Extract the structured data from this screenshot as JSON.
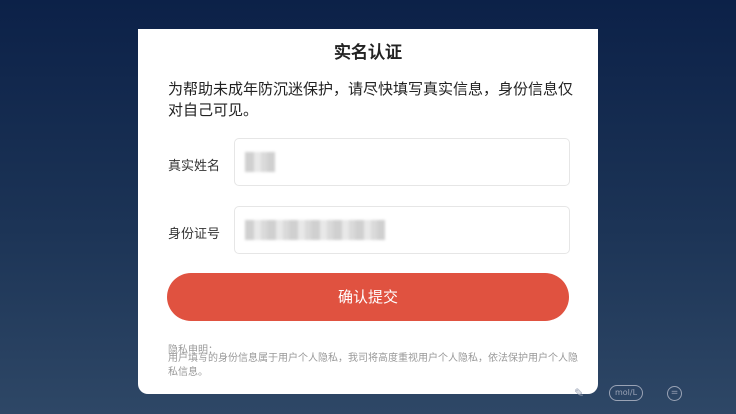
{
  "dialog": {
    "title": "实名认证",
    "intro": "为帮助未成年防沉迷保护，请尽快填写真实信息，身份信息仅对自己可见。",
    "fields": [
      {
        "label": "真实姓名",
        "value": ""
      },
      {
        "label": "身份证号",
        "value": ""
      }
    ],
    "submit_label": "确认提交",
    "privacy_title": "隐私申明：",
    "privacy_text": "用户填写的身份信息属于用户个人隐私，我司将高度重视用户个人隐私，依法保护用户个人隐私信息。"
  },
  "background_icons": {
    "unit_badge": "mol/L",
    "circle_icon": "equals-circle-icon",
    "edit_icon": "pen-icon"
  },
  "colors": {
    "accent": "#e05240",
    "background_top": "#0c2148",
    "background_bottom": "#2e4766"
  }
}
